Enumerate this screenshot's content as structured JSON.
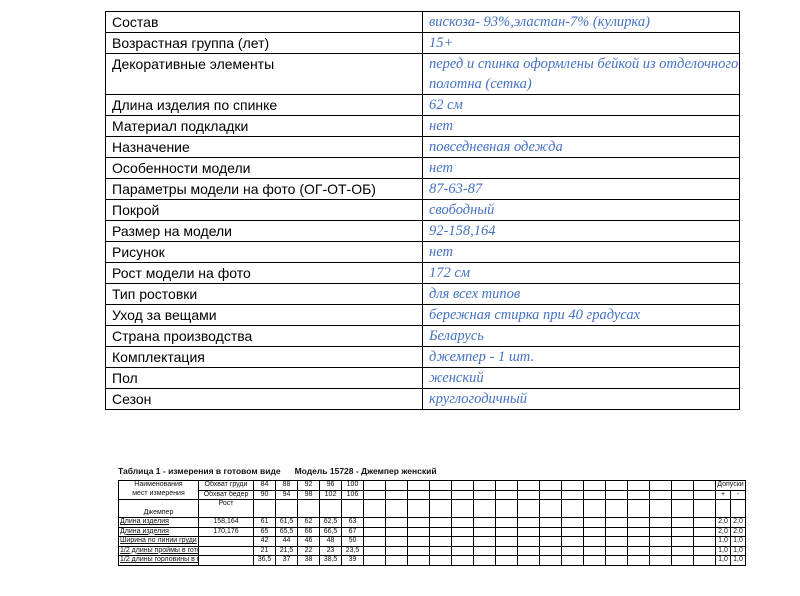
{
  "spec_rows": [
    {
      "label": "Состав",
      "value": "вискоза- 93%,эластан-7% (кулирка)"
    },
    {
      "label": "Возрастная группа (лет)",
      "value": "15+"
    },
    {
      "label": "Декоративные элементы",
      "value": "перед и спинка оформлены бейкой из отделочного полотна (сетка)"
    },
    {
      "label": "Длина изделия по спинке",
      "value": "62 см"
    },
    {
      "label": "Материал подкладки",
      "value": "нет"
    },
    {
      "label": "Назначение",
      "value": "повседневная одежда"
    },
    {
      "label": "Особенности модели",
      "value": " нет"
    },
    {
      "label": "Параметры модели на фото (ОГ-ОТ-ОБ)",
      "value": "87-63-87"
    },
    {
      "label": "Покрой",
      "value": "свободный"
    },
    {
      "label": "Размер на модели",
      "value": "92-158,164"
    },
    {
      "label": "Рисунок",
      "value": "нет"
    },
    {
      "label": "Рост модели на фото",
      "value": "172 см"
    },
    {
      "label": "Тип ростовки",
      "value": "для всех типов"
    },
    {
      "label": "Уход за вещами",
      "value": "бережная стирка при 40 градусах"
    },
    {
      "label": "Страна производства",
      "value": "Беларусь"
    },
    {
      "label": "Комплектация",
      "value": "джемпер  - 1 шт."
    },
    {
      "label": "Пол",
      "value": "женский"
    },
    {
      "label": "Сезон",
      "value": "круглогодичный"
    }
  ],
  "measurements": {
    "title": "Таблица 1 - измерения в готовом виде",
    "model": "Модель 15728 - Джемпер женский",
    "header_name_1": "Наименования",
    "header_name_2": "мест измерения",
    "chest_label": "Обхват груди",
    "chest_values": [
      "84",
      "88",
      "92",
      "96",
      "100"
    ],
    "hips_label": "Обхват бедер",
    "hips_values": [
      "90",
      "94",
      "98",
      "102",
      "106"
    ],
    "height_label": "Рост",
    "tolerance_label": "Допуски",
    "tolerance_signs": [
      "+",
      "-"
    ],
    "product_label": "Джемпер",
    "rows": [
      {
        "name": "Длина изделия",
        "growth": "158,164",
        "values": [
          "61",
          "61,5",
          "62",
          "62,5",
          "63"
        ],
        "tol_plus": "2,0",
        "tol_minus": "2,0"
      },
      {
        "name": "Длина изделия",
        "growth": "170,176",
        "values": [
          "65",
          "65,5",
          "66",
          "66,5",
          "67"
        ],
        "tol_plus": "2,0",
        "tol_minus": "2,0"
      },
      {
        "name": "Ширина по линии груди",
        "growth": "",
        "values": [
          "42",
          "44",
          "46",
          "48",
          "50"
        ],
        "tol_plus": "1,0",
        "tol_minus": "1,0"
      },
      {
        "name": "1/2 длины проймы в готово",
        "growth": "",
        "values": [
          "21",
          "21,5",
          "22",
          "23",
          "23,5"
        ],
        "tol_plus": "1,0",
        "tol_minus": "1,0"
      },
      {
        "name": "1/2 длины горловины в гото",
        "growth": "",
        "values": [
          "36,5",
          "37",
          "38",
          "38,5",
          "39"
        ],
        "tol_plus": "1,0",
        "tol_minus": "1,0"
      }
    ]
  }
}
